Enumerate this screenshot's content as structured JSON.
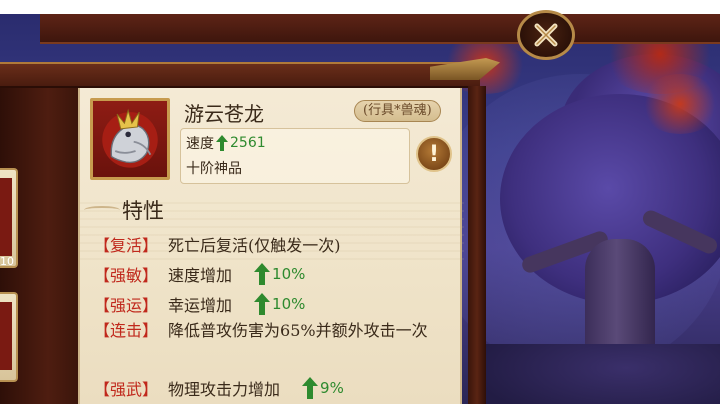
{
  "item": {
    "name": "游云苍龙",
    "type_badge": "(行具*兽魂)",
    "speed_label": "速度",
    "speed_value": "2561",
    "grade": "十阶神品"
  },
  "traits_title": "特性",
  "traits": [
    {
      "tag": "【复活】",
      "text": "死亡后复活(仅触发一次)",
      "pct": ""
    },
    {
      "tag": "【强敏】",
      "text": "速度增加",
      "pct": "10%"
    },
    {
      "tag": "【强运】",
      "text": "幸运增加",
      "pct": "10%"
    },
    {
      "tag": "【连击】",
      "text": "降低普攻伤害为65%并额外攻击一次",
      "pct": ""
    },
    {
      "tag": "【强武】",
      "text": "物理攻击力增加",
      "pct": "9%"
    }
  ],
  "side_card_number": "10",
  "icons": {
    "close": "close-x-icon",
    "info": "exclamation-icon",
    "up": "green-up-arrow-icon"
  },
  "colors": {
    "tag_red": "#c0281c",
    "up_green": "#2e8a2e",
    "card_bg": "#f4ead5"
  }
}
